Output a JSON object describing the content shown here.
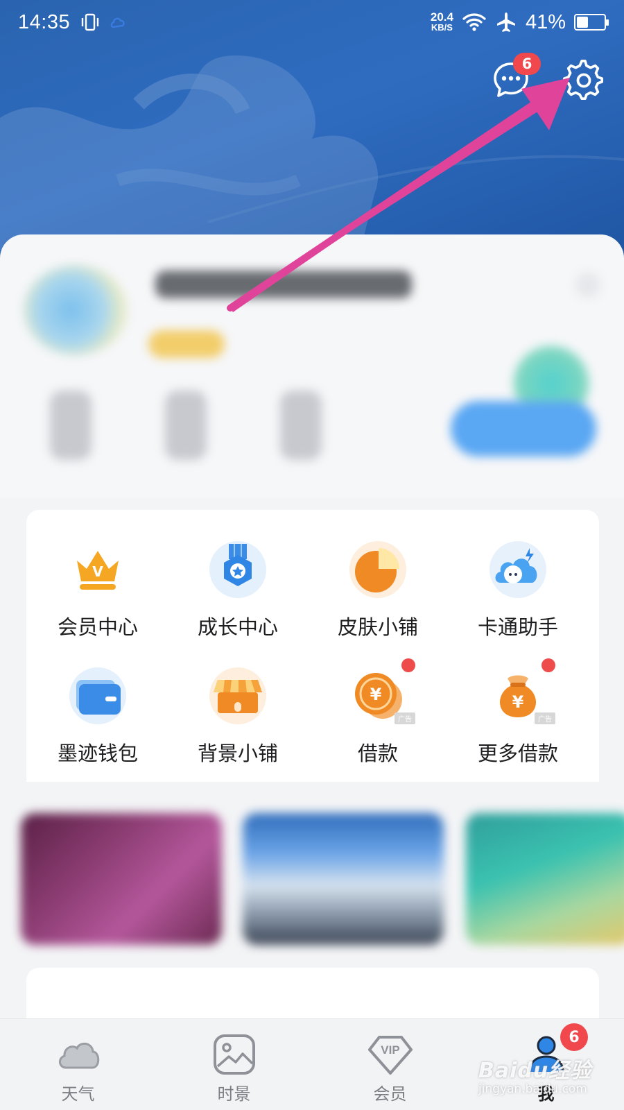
{
  "status_bar": {
    "time": "14:35",
    "net_speed_value": "20.4",
    "net_speed_unit": "KB/S",
    "battery_percent": "41%",
    "battery_level": 0.41
  },
  "header": {
    "message_badge": "6"
  },
  "services": [
    {
      "label": "会员中心",
      "icon": "crown-icon"
    },
    {
      "label": "成长中心",
      "icon": "medal-icon"
    },
    {
      "label": "皮肤小铺",
      "icon": "pie-chart-icon"
    },
    {
      "label": "卡通助手",
      "icon": "cartoon-cloud-icon"
    },
    {
      "label": "墨迹钱包",
      "icon": "wallet-icon"
    },
    {
      "label": "背景小铺",
      "icon": "shop-icon"
    },
    {
      "label": "借款",
      "icon": "coin-icon",
      "ad_tag": "广告"
    },
    {
      "label": "更多借款",
      "icon": "money-bag-icon",
      "ad_tag": "广告"
    }
  ],
  "bottom_nav": {
    "items": [
      {
        "label": "天气",
        "icon": "cloud-icon"
      },
      {
        "label": "时景",
        "icon": "image-icon"
      },
      {
        "label": "会员",
        "icon": "vip-diamond-icon"
      },
      {
        "label": "我",
        "icon": "person-icon"
      }
    ],
    "active_index": 3,
    "me_badge": "6"
  },
  "watermark": {
    "main": "Baidu经验",
    "sub": "jingyan.baidu.com"
  },
  "colors": {
    "header_blue": "#2a64b0",
    "badge_red": "#f0484d",
    "annotation_arrow": "#e0449a"
  }
}
